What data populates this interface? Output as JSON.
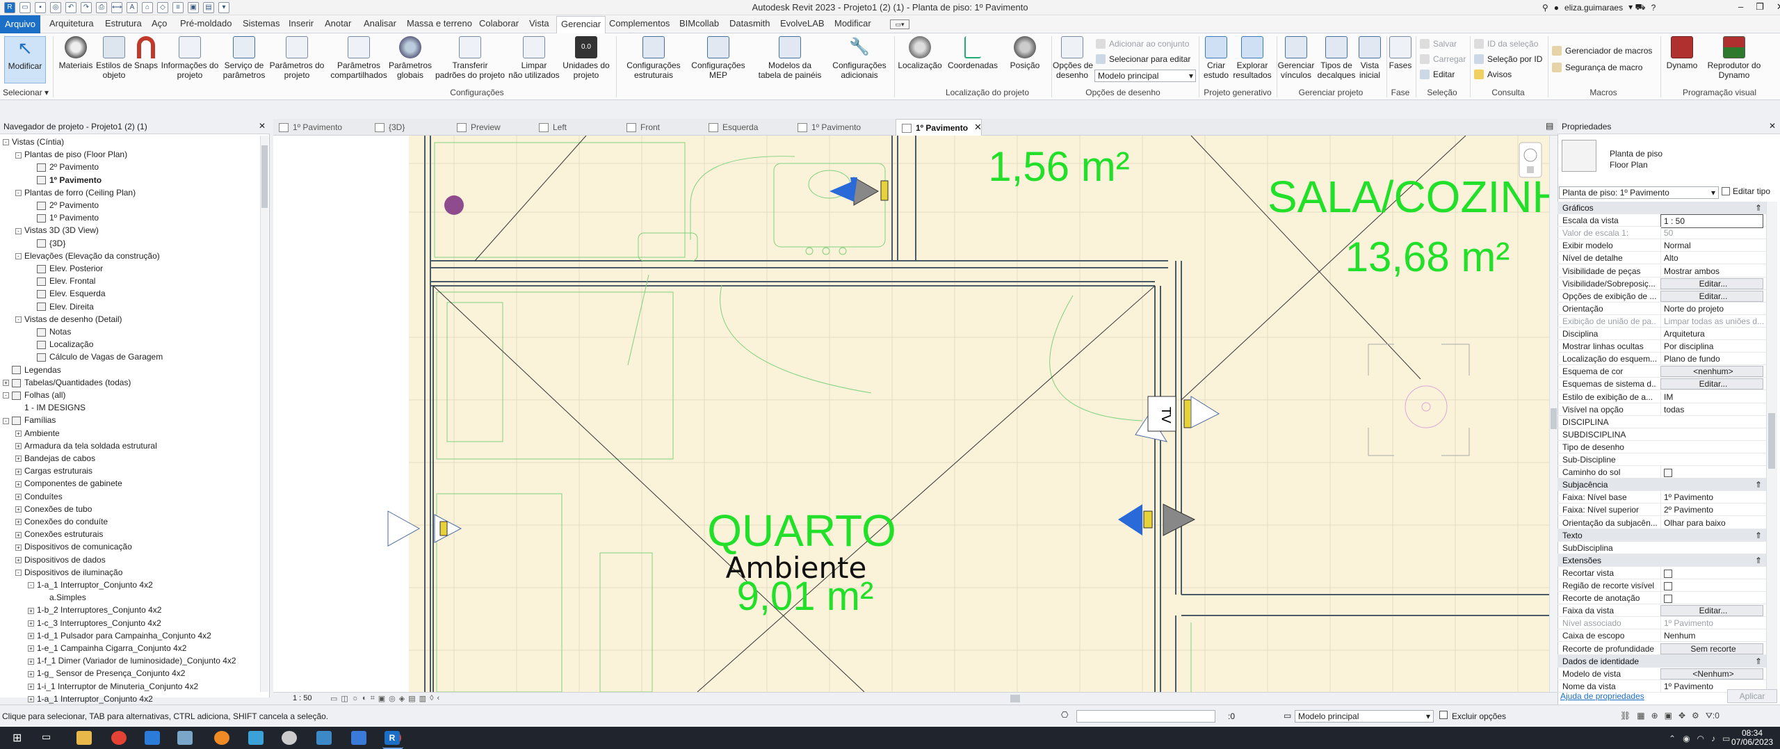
{
  "window": {
    "title": "Autodesk Revit 2023 - Projeto1 (2) (1) - Planta de piso: 1º Pavimento",
    "user": "eliza.guimaraes"
  },
  "menu": {
    "tabs": [
      "Arquivo",
      "Arquitetura",
      "Estrutura",
      "Aço",
      "Pré-moldado",
      "Sistemas",
      "Inserir",
      "Anotar",
      "Analisar",
      "Massa e terreno",
      "Colaborar",
      "Vista",
      "Gerenciar",
      "Complementos",
      "BIMcollab",
      "Datasmith",
      "EvolveLAB",
      "Modificar"
    ],
    "active": "Gerenciar"
  },
  "ribbon": {
    "modify": "Modificar",
    "select": "Selecionar",
    "buttons": [
      {
        "label": "Materiais"
      },
      {
        "label": "Estilos de\nobjeto"
      },
      {
        "label": "Snaps"
      },
      {
        "label": "Informações do\nprojeto"
      },
      {
        "label": "Serviço de\nparâmetros"
      },
      {
        "label": "Parâmetros do\nprojeto"
      },
      {
        "label": "Parâmetros\ncompartilhados"
      },
      {
        "label": "Parâmetros\nglobais"
      },
      {
        "label": "Transferir\npadrões do projeto"
      },
      {
        "label": "Limpar\nnão utilizados"
      },
      {
        "label": "Unidades do\nprojeto"
      },
      {
        "label": "Configurações\nestruturais"
      },
      {
        "label": "Configurações\nMEP"
      },
      {
        "label": "Modelos da\ntabela de painéis"
      },
      {
        "label": "Configurações\nadicionais"
      },
      {
        "label": "Localização"
      },
      {
        "label": "Coordenadas"
      },
      {
        "label": "Posição"
      },
      {
        "label": "Opções de\ndesenho"
      },
      {
        "label": "Criar\nestudo"
      },
      {
        "label": "Explorar\nresultados"
      },
      {
        "label": "Gerenciar\nvínculos"
      },
      {
        "label": "Tipos de\ndecalques"
      },
      {
        "label": "Vista\ninicial"
      },
      {
        "label": "Fases"
      },
      {
        "label": "Dynamo"
      },
      {
        "label": "Reprodutor do\nDynamo"
      }
    ],
    "small": {
      "add_set": "Adicionar ao conjunto",
      "select_edit": "Selecionar para editar",
      "main_model": "Modelo principal",
      "save": "Salvar",
      "load": "Carregar",
      "edit": "Editar",
      "id_sel": "ID da seleção",
      "sel_by_id": "Seleção  por ID",
      "warnings": "Avisos",
      "macro_mgr": "Gerenciador de  macros",
      "macro_sec": "Segurança de  macro"
    },
    "groups": {
      "config": "Configurações",
      "loc": "Localização do projeto",
      "design": "Opções de desenho",
      "gen": "Projeto generativo",
      "manage": "Gerenciar projeto",
      "phase": "Fase",
      "selection": "Seleção",
      "consult": "Consulta",
      "macros": "Macros",
      "visual": "Programação visual"
    }
  },
  "navigator": {
    "header": "Navegador de projeto - Projeto1 (2) (1)",
    "items": [
      {
        "t": "Vistas (Cíntia)",
        "l": 0,
        "e": "-"
      },
      {
        "t": "Plantas de piso (Floor Plan)",
        "l": 1,
        "e": "-"
      },
      {
        "t": "2º Pavimento",
        "l": 2,
        "v": 1
      },
      {
        "t": "1º Pavimento",
        "l": 2,
        "v": 1,
        "b": 1
      },
      {
        "t": "Plantas de forro (Ceiling Plan)",
        "l": 1,
        "e": "-"
      },
      {
        "t": "2º Pavimento",
        "l": 2,
        "v": 1
      },
      {
        "t": "1º Pavimento",
        "l": 2,
        "v": 1
      },
      {
        "t": "Vistas 3D (3D View)",
        "l": 1,
        "e": "-"
      },
      {
        "t": "{3D}",
        "l": 2,
        "v": 1
      },
      {
        "t": "Elevações (Elevação da construção)",
        "l": 1,
        "e": "-"
      },
      {
        "t": "Elev. Posterior",
        "l": 2,
        "v": 1
      },
      {
        "t": "Elev. Frontal",
        "l": 2,
        "v": 1
      },
      {
        "t": "Elev. Esquerda",
        "l": 2,
        "v": 1
      },
      {
        "t": "Elev. Direita",
        "l": 2,
        "v": 1
      },
      {
        "t": "Vistas de desenho (Detail)",
        "l": 1,
        "e": "-"
      },
      {
        "t": "Notas",
        "l": 2,
        "v": 1
      },
      {
        "t": "Localização",
        "l": 2,
        "v": 1
      },
      {
        "t": "Cálculo de Vagas de Garagem",
        "l": 2,
        "v": 1
      },
      {
        "t": "Legendas",
        "l": 0,
        "v": 1
      },
      {
        "t": "Tabelas/Quantidades (todas)",
        "l": 0,
        "e": "+",
        "v": 1
      },
      {
        "t": "Folhas (all)",
        "l": 0,
        "e": "-",
        "v": 1
      },
      {
        "t": "1 - IM DESIGNS",
        "l": 1
      },
      {
        "t": "Famílias",
        "l": 0,
        "e": "-",
        "v": 1
      },
      {
        "t": "Ambiente",
        "l": 1,
        "e": "+"
      },
      {
        "t": "Armadura da tela soldada estrutural",
        "l": 1,
        "e": "+"
      },
      {
        "t": "Bandejas de cabos",
        "l": 1,
        "e": "+"
      },
      {
        "t": "Cargas estruturais",
        "l": 1,
        "e": "+"
      },
      {
        "t": "Componentes de gabinete",
        "l": 1,
        "e": "+"
      },
      {
        "t": "Conduítes",
        "l": 1,
        "e": "+"
      },
      {
        "t": "Conexões de tubo",
        "l": 1,
        "e": "+"
      },
      {
        "t": "Conexões do conduíte",
        "l": 1,
        "e": "+"
      },
      {
        "t": "Conexões estruturais",
        "l": 1,
        "e": "+"
      },
      {
        "t": "Dispositivos de comunicação",
        "l": 1,
        "e": "+"
      },
      {
        "t": "Dispositivos de dados",
        "l": 1,
        "e": "+"
      },
      {
        "t": "Dispositivos de iluminação",
        "l": 1,
        "e": "-"
      },
      {
        "t": "1-a_1 Interruptor_Conjunto 4x2",
        "l": 2,
        "e": "-"
      },
      {
        "t": "a.Simples",
        "l": 3
      },
      {
        "t": "1-b_2 Interruptores_Conjunto 4x2",
        "l": 2,
        "e": "+"
      },
      {
        "t": "1-c_3 Interruptores_Conjunto 4x2",
        "l": 2,
        "e": "+"
      },
      {
        "t": "1-d_1 Pulsador para Campainha_Conjunto 4x2",
        "l": 2,
        "e": "+"
      },
      {
        "t": "1-e_1 Campainha Cigarra_Conjunto 4x2",
        "l": 2,
        "e": "+"
      },
      {
        "t": "1-f_1 Dimer (Variador de luminosidade)_Conjunto 4x2",
        "l": 2,
        "e": "+"
      },
      {
        "t": "1-g_ Sensor de Presença_Conjunto 4x2",
        "l": 2,
        "e": "+"
      },
      {
        "t": "1-i_1 Interruptor de Minuteria_Conjunto 4x2",
        "l": 2,
        "e": "+"
      },
      {
        "t": "1-a_1 Interruptor_Conjunto 4x2",
        "l": 2,
        "e": "+"
      }
    ]
  },
  "doctabs": [
    "1º Pavimento",
    "{3D}",
    "Preview",
    "Left",
    "Front",
    "Esquerda",
    "1º Pavimento",
    "1º Pavimento"
  ],
  "canvas": {
    "room1_area": "1,56 m²",
    "room2_name": "SALA/COZINHA",
    "room2_area": "13,68 m²",
    "room3_name": "QUARTO",
    "room3_sub": "Ambiente",
    "room3_area": "9,01 m²",
    "tv": "TV"
  },
  "viewbar": {
    "scale": "1 : 50"
  },
  "properties": {
    "header": "Propriedades",
    "type1": "Planta de piso",
    "type2": "Floor Plan",
    "selector": "Planta de piso: 1º Pavimento",
    "edit_type": "Editar tipo",
    "rows": [
      {
        "k": "Gráficos",
        "cat": 1
      },
      {
        "k": "Escala da vista",
        "v": "1 : 50"
      },
      {
        "k": "Valor de escala    1:",
        "v": "50",
        "d": 1
      },
      {
        "k": "Exibir modelo",
        "v": "Normal"
      },
      {
        "k": "Nível de detalhe",
        "v": "Alto"
      },
      {
        "k": "Visibilidade de peças",
        "v": "Mostrar ambos"
      },
      {
        "k": "Visibilidade/Sobreposiç...",
        "v": "Editar...",
        "b": 1
      },
      {
        "k": "Opções de exibição de ...",
        "v": "Editar...",
        "b": 1
      },
      {
        "k": "Orientação",
        "v": "Norte do projeto"
      },
      {
        "k": "Exibição de união de pa...",
        "v": "Limpar todas as uniões d...",
        "d": 1
      },
      {
        "k": "Disciplina",
        "v": "Arquitetura"
      },
      {
        "k": "Mostrar linhas ocultas",
        "v": "Por disciplina"
      },
      {
        "k": "Localização do esquem...",
        "v": "Plano de fundo"
      },
      {
        "k": "Esquema de cor",
        "v": "<nenhum>",
        "b": 1
      },
      {
        "k": "Esquemas de sistema d...",
        "v": "Editar...",
        "b": 1
      },
      {
        "k": "Estilo de exibição de a...",
        "v": "IM"
      },
      {
        "k": "Visível na opção",
        "v": "todas"
      },
      {
        "k": "DISCIPLINA",
        "v": ""
      },
      {
        "k": "SUBDISCIPLINA",
        "v": ""
      },
      {
        "k": "Tipo de desenho",
        "v": ""
      },
      {
        "k": "Sub-Discipline",
        "v": ""
      },
      {
        "k": "Caminho do sol",
        "c": 1
      },
      {
        "k": "Subjacência",
        "cat": 1
      },
      {
        "k": "Faixa: Nível base",
        "v": "1º Pavimento"
      },
      {
        "k": "Faixa: Nível superior",
        "v": "2º Pavimento"
      },
      {
        "k": "Orientação da subjacên...",
        "v": "Olhar para baixo"
      },
      {
        "k": "Texto",
        "cat": 1
      },
      {
        "k": "SubDisciplina",
        "v": ""
      },
      {
        "k": "Extensões",
        "cat": 1
      },
      {
        "k": "Recortar vista",
        "c": 1
      },
      {
        "k": "Região de recorte visível",
        "c": 1
      },
      {
        "k": "Recorte de anotação",
        "c": 1
      },
      {
        "k": "Faixa da vista",
        "v": "Editar...",
        "b": 1
      },
      {
        "k": "Nível associado",
        "v": "1º Pavimento",
        "d": 1
      },
      {
        "k": "Caixa de escopo",
        "v": "Nenhum"
      },
      {
        "k": "Recorte de profundidade",
        "v": "Sem recorte",
        "b": 1
      },
      {
        "k": "Dados de identidade",
        "cat": 1
      },
      {
        "k": "Modelo de vista",
        "v": "<Nenhum>",
        "b": 1
      },
      {
        "k": "Nome da vista",
        "v": "1º Pavimento"
      }
    ],
    "help": "Ajuda de propriedades",
    "apply": "Aplicar"
  },
  "status": {
    "text": "Clique para selecionar, TAB para alternativas, CTRL adiciona, SHIFT cancela a seleção.",
    "zero": ":0",
    "model": "Modelo principal",
    "exclude": "Excluir opções"
  },
  "taskbar": {
    "time": "08:34",
    "date": "07/06/2023"
  }
}
